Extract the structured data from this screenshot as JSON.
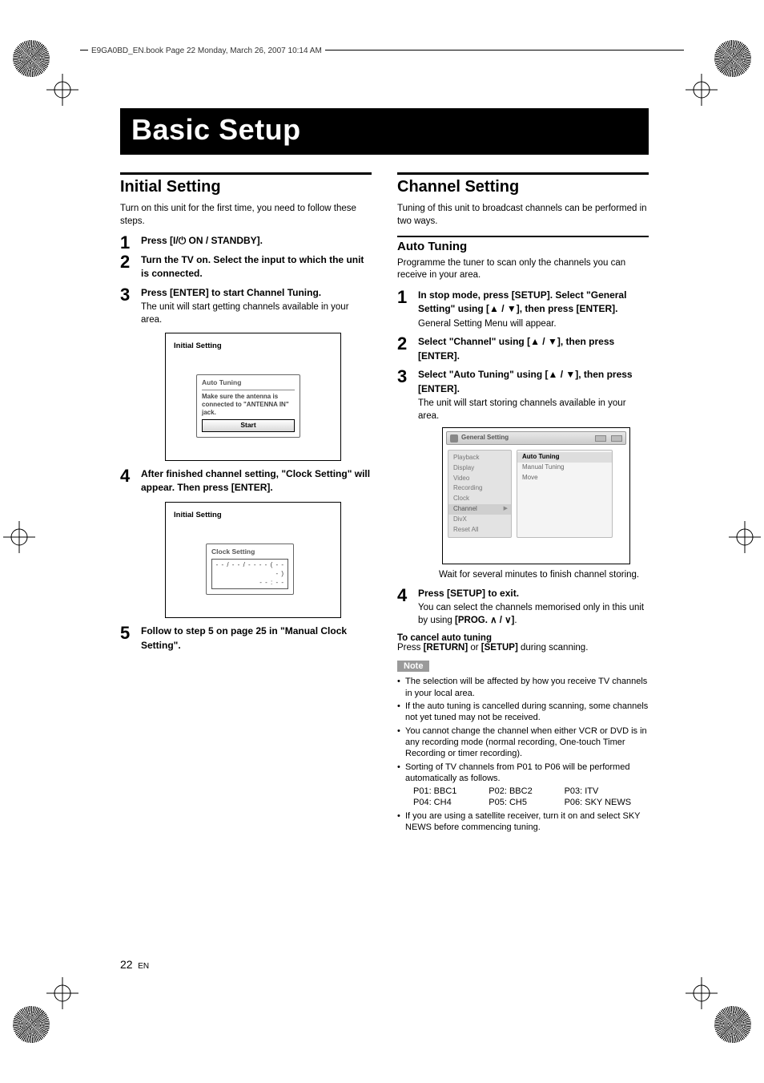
{
  "header_tag": "E9GA0BD_EN.book  Page 22  Monday, March 26, 2007  10:14 AM",
  "page_title": "Basic Setup",
  "page_number": "22",
  "page_lang": "EN",
  "left": {
    "section_title": "Initial Setting",
    "intro": "Turn on this unit for the first time, you need to follow these steps.",
    "steps": [
      {
        "n": "1",
        "head_pre": "Press [",
        "head_post": " ON / STANDBY]."
      },
      {
        "n": "2",
        "head": "Turn the TV on. Select the input to which the unit is connected."
      },
      {
        "n": "3",
        "head": "Press [ENTER] to start Channel Tuning.",
        "body": "The unit will start getting channels available in your area."
      },
      {
        "n": "4",
        "head": "After finished channel setting, \"Clock Setting\" will appear. Then press [ENTER]."
      },
      {
        "n": "5",
        "head": "Follow to step 5 on page 25 in \"Manual Clock Setting\"."
      }
    ],
    "osd_tuning": {
      "window_title": "Initial Setting",
      "panel_title": "Auto Tuning",
      "msg_l1": "Make sure the antenna is",
      "msg_l2": "connected to \"ANTENNA IN\" jack.",
      "button": "Start"
    },
    "osd_clock": {
      "window_title": "Initial Setting",
      "panel_title": "Clock Setting",
      "line1": "- - / - - / - - - -  ( - - - )",
      "line2": "- - : - -"
    }
  },
  "right": {
    "section_title": "Channel Setting",
    "intro": "Tuning of this unit to broadcast channels can be performed in two ways.",
    "sub_title": "Auto Tuning",
    "sub_intro": "Programme the tuner to scan only the channels you can receive in your area.",
    "steps": [
      {
        "n": "1",
        "head": "In stop mode, press [SETUP]. Select \"General Setting\" using [▲ / ▼], then press [ENTER].",
        "body": "General Setting Menu will appear."
      },
      {
        "n": "2",
        "head": "Select \"Channel\" using [▲ / ▼], then press [ENTER]."
      },
      {
        "n": "3",
        "head": "Select \"Auto Tuning\" using [▲ / ▼], then press [ENTER].",
        "body": "The unit will start storing channels available in your area."
      },
      {
        "n": "4",
        "head": "Press [SETUP] to exit.",
        "body_pre": "You can select the channels memorised only in this unit by using ",
        "body_bold": "[PROG. ∧ / ∨]",
        "body_post": "."
      }
    ],
    "osd": {
      "title": "General Setting",
      "menu": [
        "Playback",
        "Display",
        "Video",
        "Recording",
        "Clock",
        "Channel",
        "DivX",
        "Reset All"
      ],
      "selected_menu": "Channel",
      "options": [
        "Auto Tuning",
        "Manual Tuning",
        "Move"
      ],
      "highlight": "Auto Tuning"
    },
    "wait_note": "Wait for several minutes to finish channel storing.",
    "cancel_head": "To cancel auto tuning",
    "cancel_body_pre": "Press ",
    "cancel_b1": "[RETURN]",
    "cancel_mid": " or ",
    "cancel_b2": "[SETUP]",
    "cancel_body_post": " during scanning.",
    "note_label": "Note",
    "notes": [
      "The selection will be affected by how you receive TV channels in your local area.",
      "If the auto tuning is cancelled during scanning, some channels not yet tuned may not be received.",
      "You cannot change the channel when either VCR or DVD is in any recording mode (normal recording, One-touch Timer Recording or timer recording).",
      "Sorting of TV channels from P01 to P06 will be performed automatically as follows.",
      "If you are using a satellite receiver, turn it on and select SKY NEWS before commencing tuning."
    ],
    "ch_table": {
      "r1": [
        "P01: BBC1",
        "P02: BBC2",
        "P03: ITV"
      ],
      "r2": [
        "P04: CH4",
        "P05: CH5",
        "P06: SKY NEWS"
      ]
    }
  }
}
